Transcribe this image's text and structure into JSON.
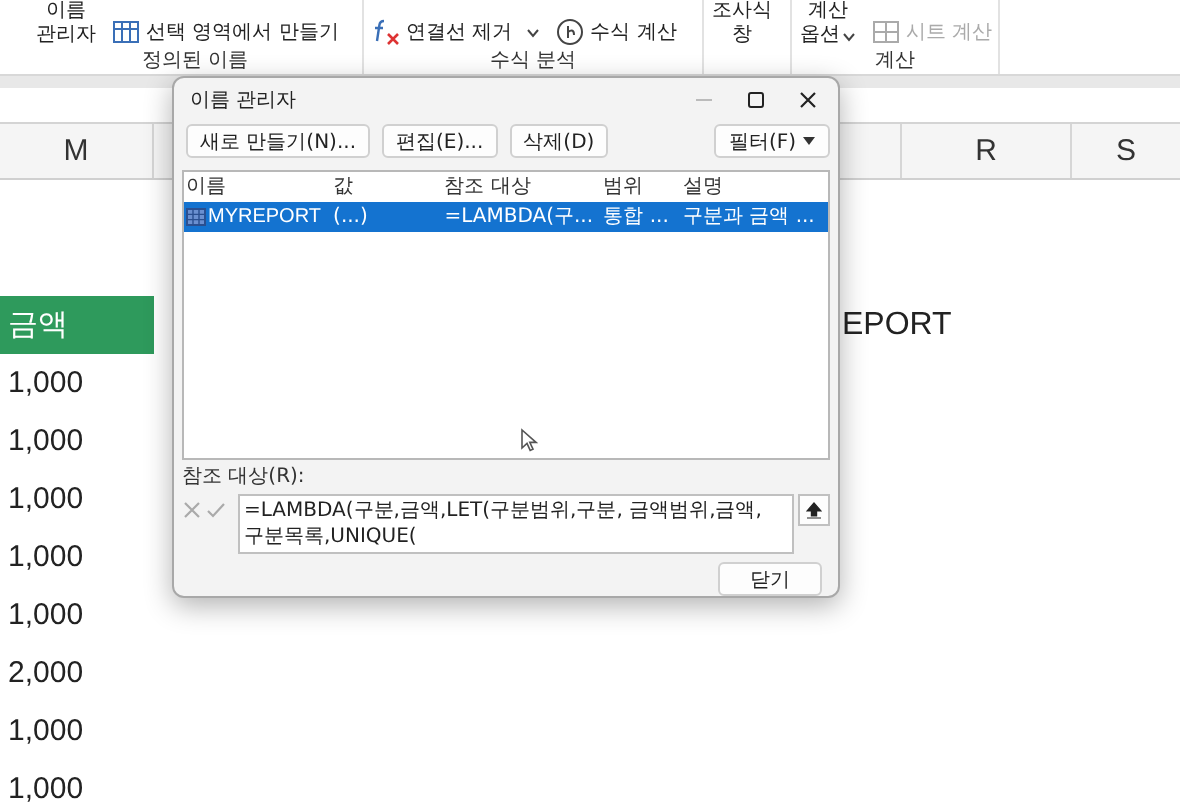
{
  "ribbon": {
    "groups": [
      {
        "label": "정의된 이름",
        "items": [
          {
            "kind": "stack",
            "lines": [
              "이름",
              "관리자"
            ]
          },
          {
            "kind": "row",
            "label": "선택 영역에서 만들기"
          }
        ]
      },
      {
        "label": "수식 분석",
        "items": [
          {
            "kind": "row",
            "label": "연결선 제거",
            "caret": true
          },
          {
            "kind": "row",
            "label": "수식 계산"
          }
        ]
      },
      {
        "items": [
          {
            "kind": "stack",
            "lines": [
              "조사식",
              "창"
            ]
          }
        ]
      },
      {
        "label": "계산",
        "items": [
          {
            "kind": "stack",
            "lines": [
              "계산",
              "옵션"
            ],
            "caret": true
          },
          {
            "kind": "row",
            "label": "시트 계산",
            "disabled": true
          }
        ]
      }
    ]
  },
  "sheet": {
    "columns": [
      {
        "label": "M"
      },
      {
        "label": "R"
      },
      {
        "label": "S"
      }
    ],
    "rows": [
      {
        "kind": "heading",
        "m": "금액",
        "title": "EPORT"
      },
      {
        "kind": "value",
        "m": "1,000"
      },
      {
        "kind": "value",
        "m": "1,000"
      },
      {
        "kind": "value",
        "m": "1,000"
      },
      {
        "kind": "value",
        "m": "1,000"
      },
      {
        "kind": "value",
        "m": "1,000"
      },
      {
        "kind": "value",
        "m": "2,000"
      },
      {
        "kind": "value",
        "m": "1,000"
      },
      {
        "kind": "value",
        "m": "1,000"
      }
    ]
  },
  "dialog": {
    "title": "이름 관리자",
    "buttons": [
      "새로 만들기(N)...",
      "편집(E)...",
      "삭제(D)"
    ],
    "filter": "필터(F)",
    "columns": [
      "이름",
      "값",
      "참조 대상",
      "범위",
      "설명"
    ],
    "names": [
      {
        "name": "MYREPORT",
        "value": "(...)",
        "refers_to": "=LAMBDA(구...",
        "scope": "통합 ...",
        "comment": "구분과 금액 ...",
        "selected": true
      }
    ],
    "refers_label": "참조 대상(R):",
    "refers_value": "=LAMBDA(구분,금액,LET(구분범위,구분, 금액범위,금액, 구분목록,UNIQUE(",
    "close": "닫기"
  }
}
